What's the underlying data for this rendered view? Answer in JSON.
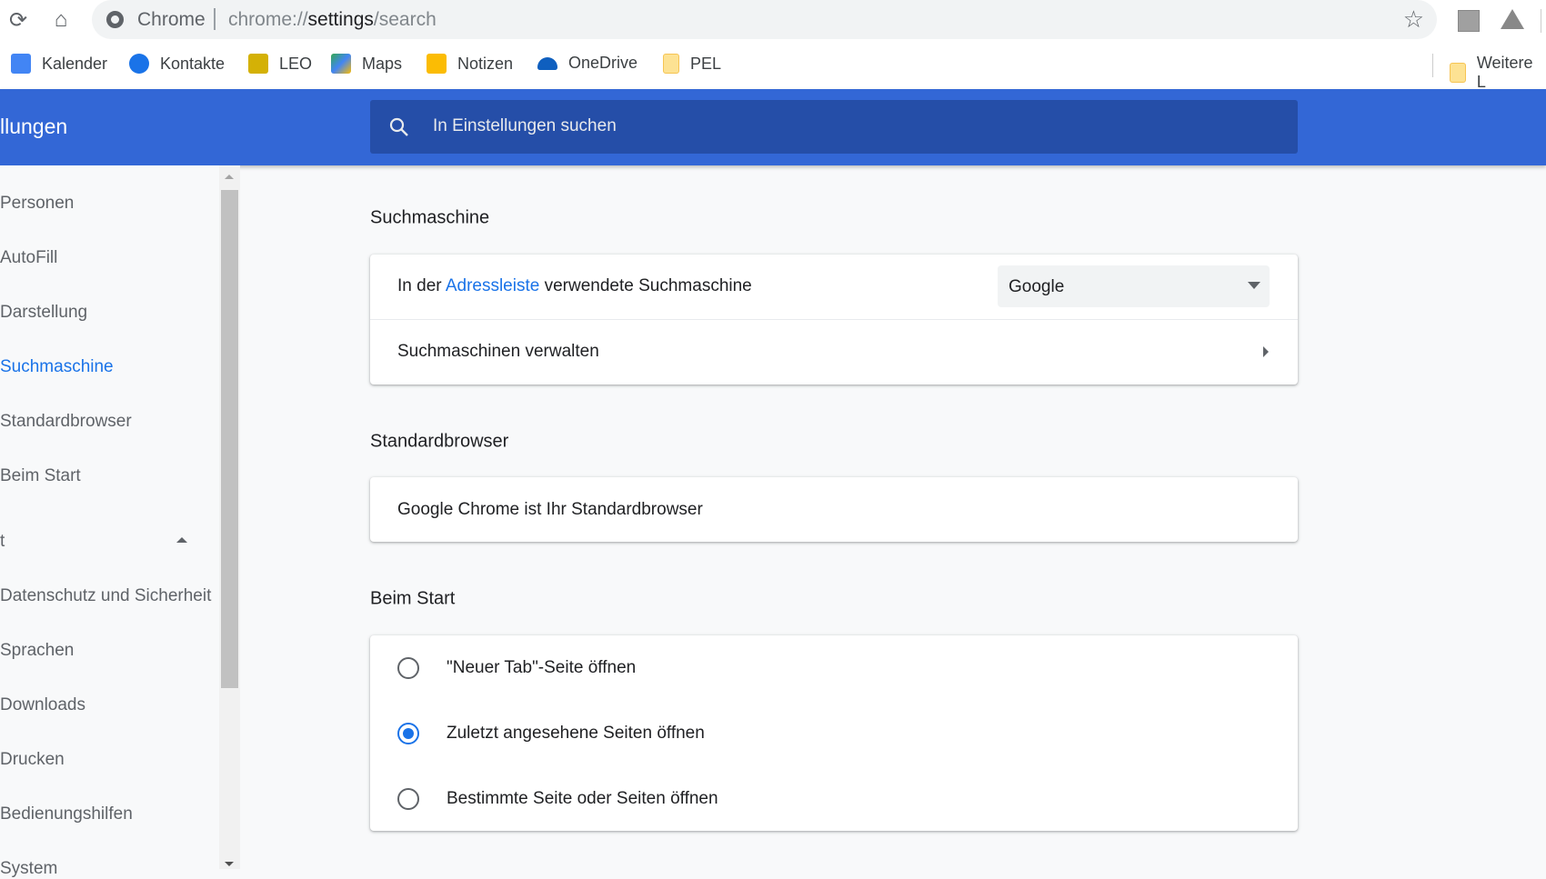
{
  "toolbar": {
    "omnibox_site": "Chrome",
    "omnibox_url_prefix": "chrome://",
    "omnibox_url_host": "settings",
    "omnibox_url_path": "/search"
  },
  "bookmarks": [
    {
      "label": "Kalender",
      "color": "#4285f4"
    },
    {
      "label": "Kontakte",
      "color": "#1a73e8"
    },
    {
      "label": "LEO",
      "color": "#d4b106"
    },
    {
      "label": "Maps",
      "color": "#34a853"
    },
    {
      "label": "Notizen",
      "color": "#fbbc04"
    },
    {
      "label": "OneDrive",
      "color": "#0f5fbf"
    },
    {
      "label": "PEL",
      "color": "#fde293"
    }
  ],
  "bookmarks_more": "Weitere L",
  "header": {
    "title": "llungen",
    "search_placeholder": "In Einstellungen suchen"
  },
  "sidebar": {
    "items": [
      "Personen",
      "AutoFill",
      "Darstellung",
      "Suchmaschine",
      "Standardbrowser",
      "Beim Start",
      "t",
      "Datenschutz und Sicherheit",
      "Sprachen",
      "Downloads",
      "Drucken",
      "Bedienungshilfen",
      "System"
    ],
    "active": "Suchmaschine"
  },
  "search_engine": {
    "title": "Suchmaschine",
    "row1_prefix": "In der ",
    "row1_link": "Adressleiste",
    "row1_suffix": " verwendete Suchmaschine",
    "selected": "Google",
    "row2": "Suchmaschinen verwalten"
  },
  "default_browser": {
    "title": "Standardbrowser",
    "text": "Google Chrome ist Ihr Standardbrowser"
  },
  "startup": {
    "title": "Beim Start",
    "options": [
      {
        "label": "\"Neuer Tab\"-Seite öffnen",
        "selected": false
      },
      {
        "label": "Zuletzt angesehene Seiten öffnen",
        "selected": true
      },
      {
        "label": "Bestimmte Seite oder Seiten öffnen",
        "selected": false
      }
    ]
  },
  "colors": {
    "accent": "#1a73e8",
    "header": "#3367d6"
  }
}
